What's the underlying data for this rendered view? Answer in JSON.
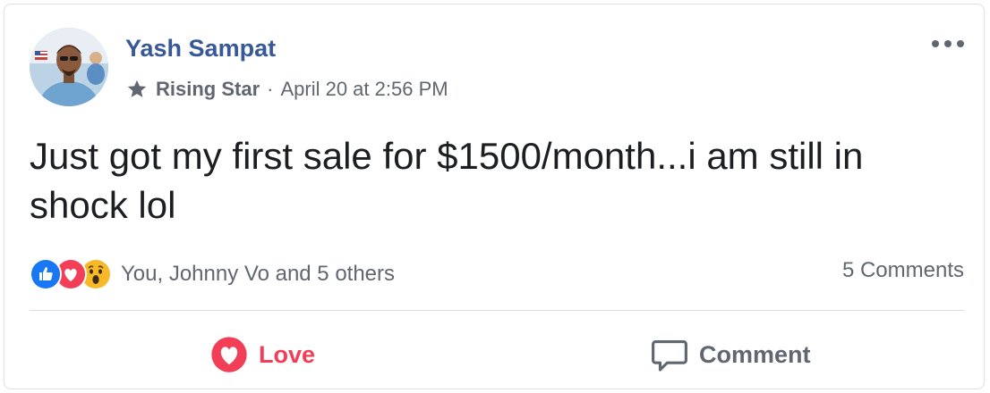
{
  "post": {
    "author": "Yash Sampat",
    "badge": "Rising Star",
    "separator": "·",
    "timestamp": "April 20 at 2:56 PM",
    "text": "Just got my first sale for $1500/month...i am still in shock lol"
  },
  "reactions": {
    "icons": [
      "like-icon",
      "love-icon",
      "wow-icon"
    ],
    "summary": "You, Johnny Vo and 5 others",
    "comments_count": "5 Comments"
  },
  "actions": {
    "love_label": "Love",
    "comment_label": "Comment"
  },
  "colors": {
    "name_blue": "#385898",
    "like_blue": "#1877f2",
    "love_red": "#f33e58",
    "wow_yellow": "#f7b928",
    "secondary_text": "#606770"
  }
}
